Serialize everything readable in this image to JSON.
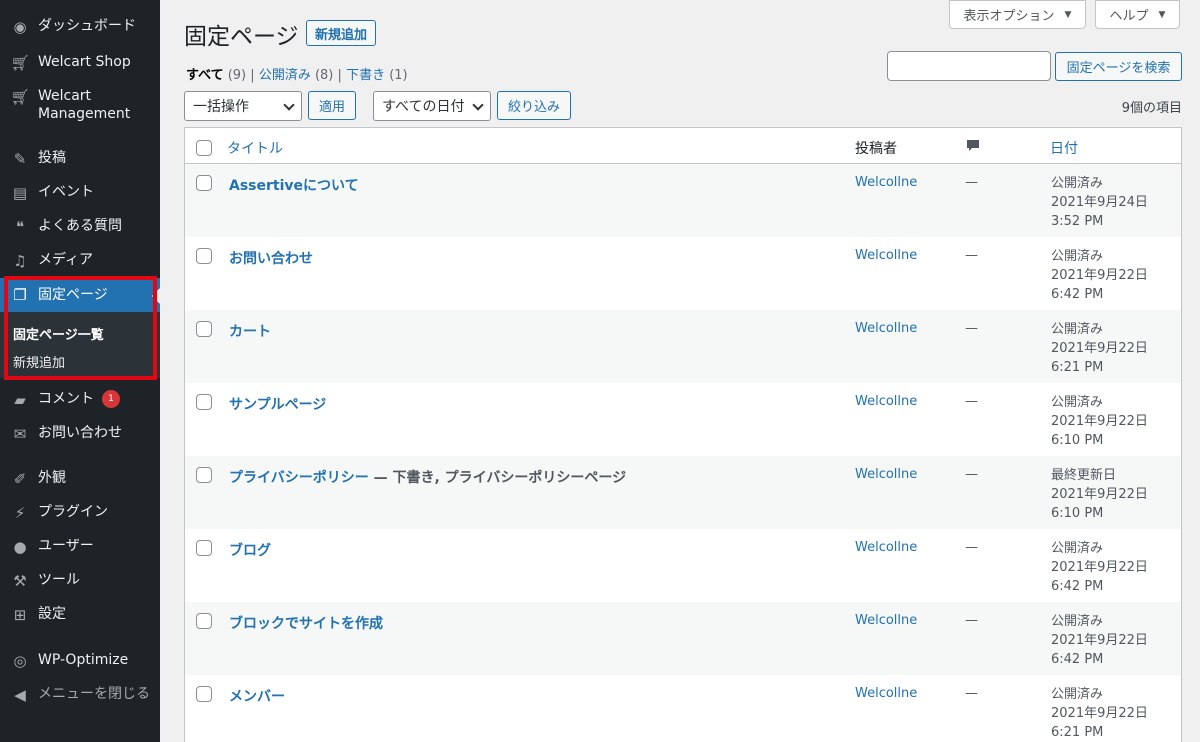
{
  "sidebar": {
    "items": [
      {
        "label": "ダッシュボード",
        "icon": "dashboard-icon"
      },
      {
        "label": "Welcart Shop",
        "icon": "cart-icon"
      },
      {
        "label": "Welcart\nManagement",
        "icon": "cart-icon"
      },
      {
        "label": "投稿",
        "icon": "pin-icon"
      },
      {
        "label": "イベント",
        "icon": "calendar-icon"
      },
      {
        "label": "よくある質問",
        "icon": "comments-icon"
      },
      {
        "label": "メディア",
        "icon": "media-icon"
      },
      {
        "label": "固定ページ",
        "icon": "pages-icon"
      },
      {
        "label": "コメント",
        "icon": "comment-icon",
        "badge": "1"
      },
      {
        "label": "お問い合わせ",
        "icon": "mail-icon"
      },
      {
        "label": "外観",
        "icon": "brush-icon"
      },
      {
        "label": "プラグイン",
        "icon": "plugin-icon"
      },
      {
        "label": "ユーザー",
        "icon": "user-icon"
      },
      {
        "label": "ツール",
        "icon": "wrench-icon"
      },
      {
        "label": "設定",
        "icon": "settings-icon"
      },
      {
        "label": "WP-Optimize",
        "icon": "optimize-icon"
      },
      {
        "label": "メニューを閉じる",
        "icon": "collapse-icon"
      }
    ],
    "submenu": [
      "固定ページ一覧",
      "新規追加"
    ]
  },
  "header": {
    "screen_options": "表示オプション",
    "help": "ヘルプ",
    "title": "固定ページ",
    "add_new": "新規追加"
  },
  "filters": {
    "all": "すべて",
    "all_count": "(9)",
    "published": "公開済み",
    "published_count": "(8)",
    "draft": "下書き",
    "draft_count": "(1)",
    "sep": "|"
  },
  "search": {
    "button": "固定ページを検索",
    "value": ""
  },
  "bulk": {
    "action": "一括操作",
    "apply": "適用",
    "dates": "すべての日付",
    "filter": "絞り込み"
  },
  "item_count": "9個の項目",
  "table": {
    "headers": {
      "title": "タイトル",
      "author": "投稿者",
      "date": "日付"
    },
    "rows": [
      {
        "title": "Assertiveについて",
        "state": "",
        "author": "Welcollne",
        "comments": "—",
        "status": "公開済み",
        "date": "2021年9月24日",
        "time": "3:52 PM"
      },
      {
        "title": "お問い合わせ",
        "state": "",
        "author": "Welcollne",
        "comments": "—",
        "status": "公開済み",
        "date": "2021年9月22日",
        "time": "6:42 PM"
      },
      {
        "title": "カート",
        "state": "",
        "author": "Welcollne",
        "comments": "—",
        "status": "公開済み",
        "date": "2021年9月22日",
        "time": "6:21 PM"
      },
      {
        "title": "サンプルページ",
        "state": "",
        "author": "Welcollne",
        "comments": "—",
        "status": "公開済み",
        "date": "2021年9月22日",
        "time": "6:10 PM"
      },
      {
        "title": "プライバシーポリシー",
        "state": " — 下書き, プライバシーポリシーページ",
        "author": "Welcollne",
        "comments": "—",
        "status": "最終更新日",
        "date": "2021年9月22日",
        "time": "6:10 PM"
      },
      {
        "title": "ブログ",
        "state": "",
        "author": "Welcollne",
        "comments": "—",
        "status": "公開済み",
        "date": "2021年9月22日",
        "time": "6:42 PM"
      },
      {
        "title": "ブロックでサイトを作成",
        "state": "",
        "author": "Welcollne",
        "comments": "—",
        "status": "公開済み",
        "date": "2021年9月22日",
        "time": "6:42 PM"
      },
      {
        "title": "メンバー",
        "state": "",
        "author": "Welcollne",
        "comments": "—",
        "status": "公開済み",
        "date": "2021年9月22日",
        "time": "6:21 PM"
      }
    ]
  }
}
